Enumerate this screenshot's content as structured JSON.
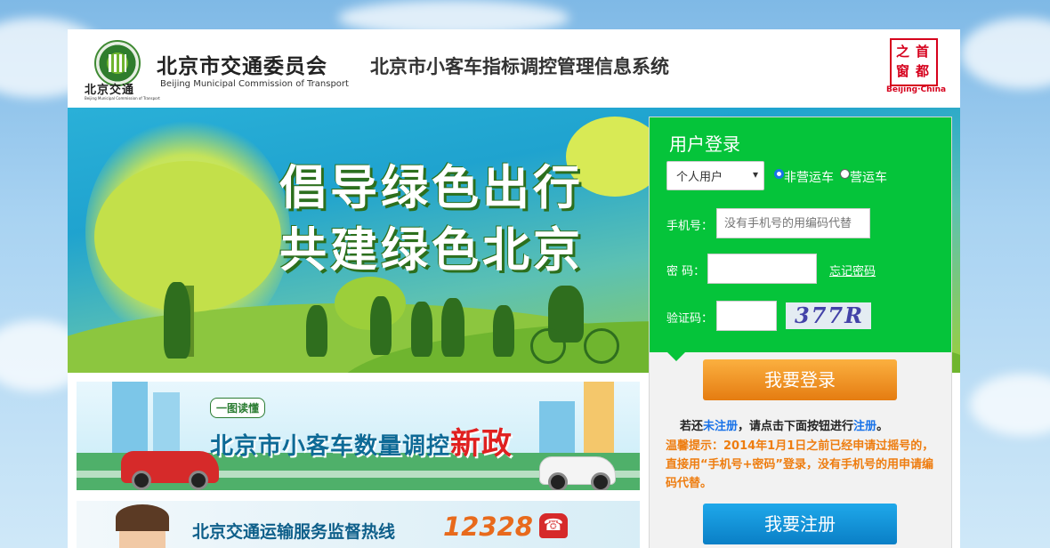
{
  "header": {
    "logo_cn": "北京交通",
    "logo_en_small": "Beijing Municipal Commission of Transport",
    "org_cn": "北京市交通委员会",
    "org_en": "Beijing Municipal Commission of Transport",
    "system_title": "北京市小客车指标调控管理信息系统",
    "seal_chars": [
      "首",
      "都",
      "之",
      "窗"
    ],
    "seal_en": "Beijing·China"
  },
  "banner": {
    "slogan_line1": "倡导绿色出行",
    "slogan_line2": "共建绿色北京"
  },
  "login": {
    "title": "用户登录",
    "user_type_selected": "个人用户",
    "radio_options": [
      {
        "label": "非营运车",
        "checked": true
      },
      {
        "label": "营运车",
        "checked": false
      }
    ],
    "phone_label": "手机号：",
    "phone_placeholder": "没有手机号的用编码代替",
    "password_label": "密 码：",
    "forgot_link": "忘记密码",
    "captcha_label": "验证码：",
    "captcha_text": "377R",
    "login_button": "我要登录",
    "register_hint_prefix": "若还",
    "register_hint_link1": "未注册",
    "register_hint_middle": "，请点击下面按钮进行",
    "register_hint_link2": "注册",
    "register_hint_suffix": "。",
    "tip": "温馨提示：2014年1月1日之前已经申请过摇号的，直接用“手机号+密码”登录，没有手机号的用申请编码代替。",
    "register_button": "我要注册"
  },
  "policy_banner": {
    "tag": "一图读懂",
    "title_prefix": "北京市小客车数量调控",
    "title_new": "新政"
  },
  "hotline_banner": {
    "text": "北京交通运输服务监督热线",
    "number": "12328"
  },
  "colors": {
    "login_green": "#05c43a",
    "login_button": "#e57c11",
    "register_button": "#0a7fc6",
    "tip_orange": "#ee7d10",
    "seal_red": "#d6001c"
  }
}
